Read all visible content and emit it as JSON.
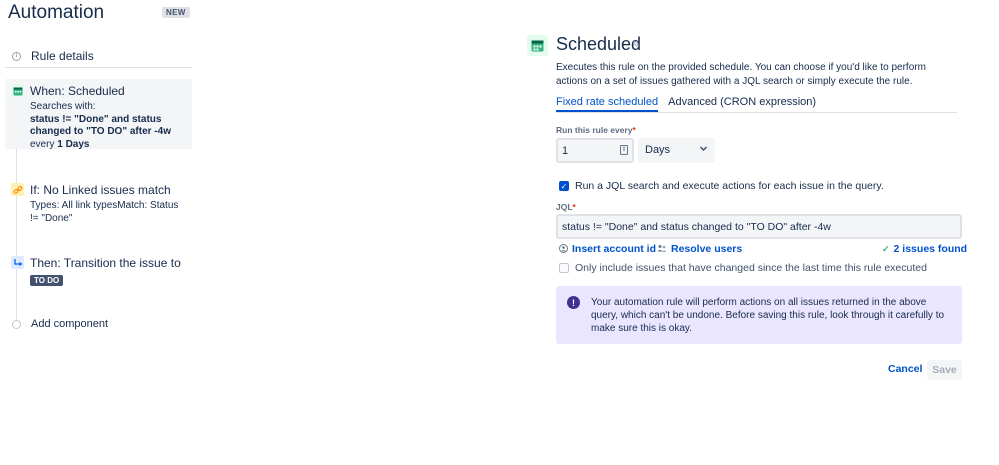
{
  "header": {
    "title": "Automation",
    "badge": "NEW"
  },
  "sidebar": {
    "rule_details": "Rule details",
    "steps": [
      {
        "title": "When: Scheduled",
        "line1": "Searches with:",
        "query": "status != \"Done\" and status changed to \"TO DO\" after -4w",
        "every_prefix": "every",
        "every_value": "1 Days",
        "icon": "calendar-icon",
        "color": "#36b37e"
      },
      {
        "title": "If: No Linked issues match",
        "line1": "Types: All link typesMatch: Status != \"Done\"",
        "icon": "link-icon",
        "color": "#ffab00"
      },
      {
        "title": "Then: Transition the issue to",
        "lozenge": "TO DO",
        "icon": "transition-icon",
        "color": "#0065ff"
      }
    ],
    "add_component": "Add component"
  },
  "main": {
    "title": "Scheduled",
    "description": "Executes this rule on the provided schedule. You can choose if you'd like to perform actions on a set of issues gathered with a JQL search or simply execute the rule.",
    "tabs": [
      "Fixed rate scheduled",
      "Advanced (CRON expression)"
    ],
    "run_every_label": "Run this rule every",
    "run_every_value": "1",
    "run_every_unit": "Days",
    "jql_checkbox_label": "Run a JQL search and execute actions for each issue in the query.",
    "jql_label": "JQL",
    "jql_value": "status != \"Done\" and status changed to \"TO DO\" after -4w",
    "insert_account_id": "Insert account id",
    "resolve_users": "Resolve users",
    "issues_found": "2 issues found",
    "only_include_label": "Only include issues that have changed since the last time this rule executed",
    "info_text": "Your automation rule will perform actions on all issues returned in the above query, which can't be undone. Before saving this rule, look through it carefully to make sure this is okay.",
    "cancel_label": "Cancel",
    "save_label": "Save"
  },
  "colors": {
    "accent": "#0052cc",
    "info_bg": "#eae6ff",
    "success": "#36b37e"
  }
}
